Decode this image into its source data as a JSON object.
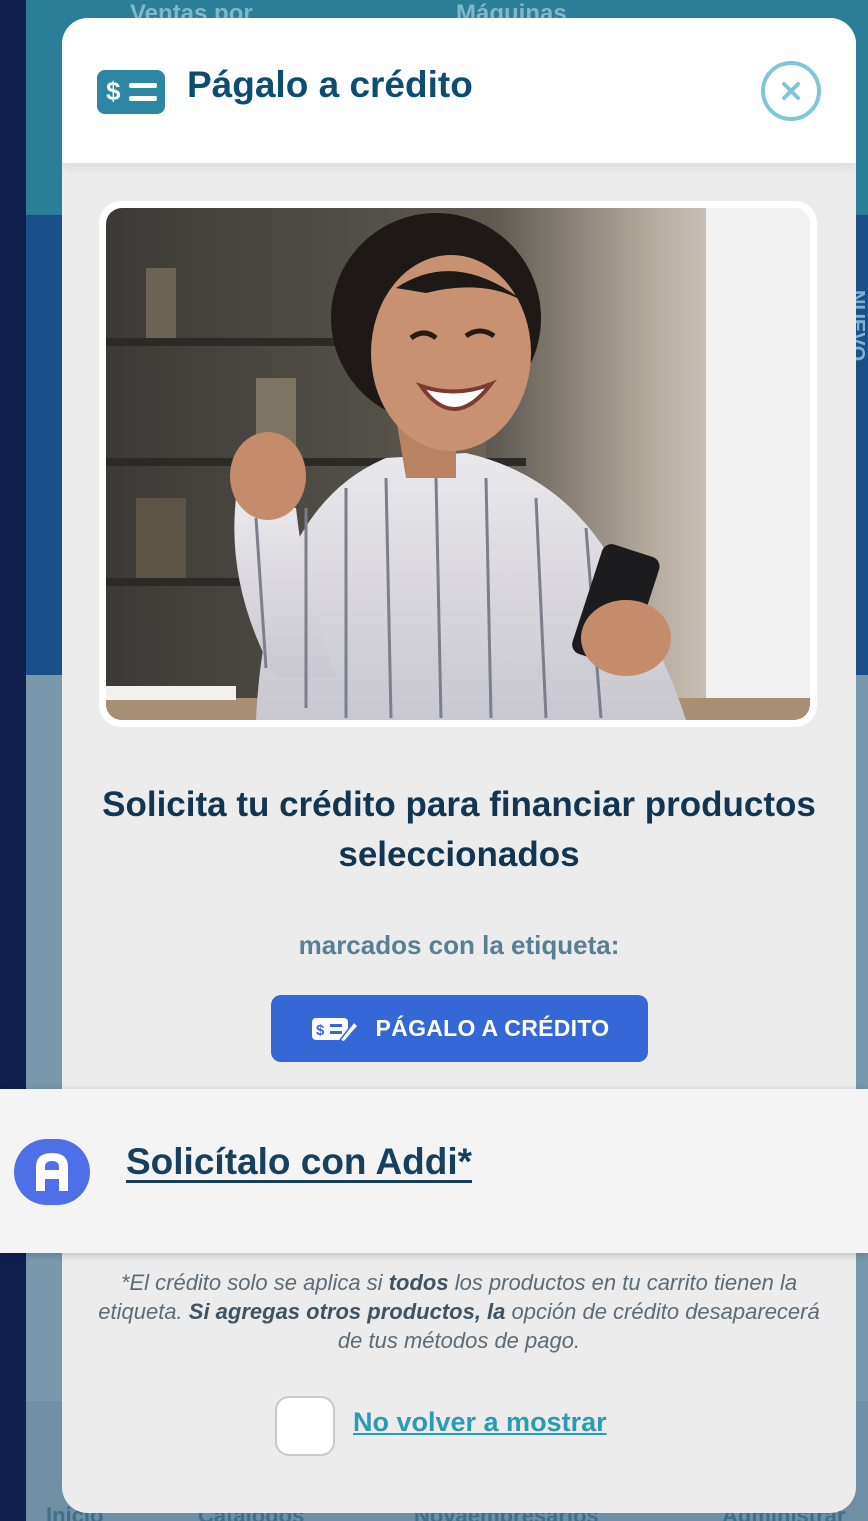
{
  "background": {
    "top_tabs": [
      "Ventas por",
      "Máquinas"
    ],
    "side_text": "NUEVO",
    "bottom_nav": [
      "Inicio",
      "Catálogos",
      "Novaempresarios",
      "Administrar"
    ]
  },
  "modal": {
    "header_icon_symbol": "$",
    "title": "Págalo a crédito",
    "close_icon": "close-circle-icon",
    "hero_image_alt": "Mujer sonriendo mirando su celular",
    "headline": "Solicita tu crédito para financiar productos seleccionados",
    "tag_caption": "marcados con la etiqueta:",
    "tag_badge_label": "PÁGALO A CRÉDITO",
    "tag_badge_icon_text": "$",
    "disclaimer": {
      "p1": "*El crédito solo se aplica si ",
      "b1": "todos",
      "p2": " los productos en tu carrito tienen la etiqueta. ",
      "b2": "Si agregas otros productos, la",
      "p3": " opción de crédito desaparecerá de tus métodos de pago."
    },
    "dont_show_label": "No volver a mostrar"
  },
  "addi_option": {
    "link_label": "Solicítalo con Addi*",
    "logo_icon": "addi-logo-icon"
  },
  "colors": {
    "title": "#0e4d73",
    "badge": "#3567d6",
    "link_teal": "#2a9bb3",
    "addi_blue": "#4f6fe8"
  }
}
